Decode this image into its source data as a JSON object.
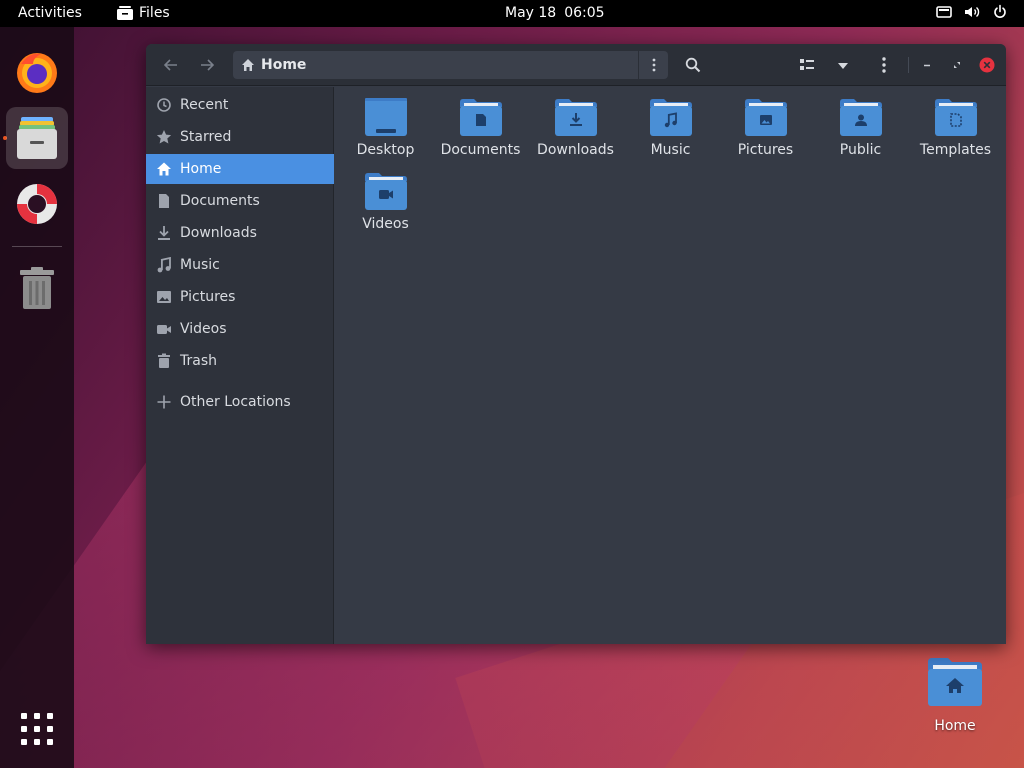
{
  "topbar": {
    "activities": "Activities",
    "app_name": "Files",
    "date": "May 18",
    "time": "06:05",
    "tray_icons": [
      "screen-icon",
      "volume-icon",
      "power-icon"
    ]
  },
  "dock": {
    "items": [
      {
        "name": "Firefox",
        "icon": "firefox-icon"
      },
      {
        "name": "Files",
        "icon": "files-icon",
        "active": true
      },
      {
        "name": "Help",
        "icon": "help-lifebuoy-icon"
      },
      {
        "name": "Trash",
        "icon": "trash-icon"
      }
    ],
    "show_apps_icon": "apps-grid-icon"
  },
  "window": {
    "path": {
      "location": "Home"
    },
    "sidebar": {
      "items": [
        {
          "label": "Recent",
          "icon": "clock-icon"
        },
        {
          "label": "Starred",
          "icon": "star-icon"
        },
        {
          "label": "Home",
          "icon": "home-icon",
          "selected": true
        },
        {
          "label": "Documents",
          "icon": "document-icon"
        },
        {
          "label": "Downloads",
          "icon": "download-icon"
        },
        {
          "label": "Music",
          "icon": "music-icon"
        },
        {
          "label": "Pictures",
          "icon": "picture-icon"
        },
        {
          "label": "Videos",
          "icon": "video-icon"
        },
        {
          "label": "Trash",
          "icon": "trash-icon"
        },
        {
          "label": "Other Locations",
          "icon": "plus-icon"
        }
      ]
    },
    "folders": [
      {
        "label": "Desktop",
        "icon": "desktop-folder-icon"
      },
      {
        "label": "Documents",
        "icon": "documents-folder-icon"
      },
      {
        "label": "Downloads",
        "icon": "downloads-folder-icon"
      },
      {
        "label": "Music",
        "icon": "music-folder-icon"
      },
      {
        "label": "Pictures",
        "icon": "pictures-folder-icon"
      },
      {
        "label": "Public",
        "icon": "public-folder-icon"
      },
      {
        "label": "Templates",
        "icon": "templates-folder-icon"
      },
      {
        "label": "Videos",
        "icon": "videos-folder-icon"
      }
    ]
  },
  "desktop": {
    "icons": [
      {
        "label": "Home",
        "icon": "home-folder-icon"
      }
    ]
  },
  "colors": {
    "accent": "#4a90e2",
    "folder": "#4a8fd6",
    "window_bg": "#353a45",
    "sidebar_bg": "#2e323b",
    "headerbar_bg": "#2b2f37",
    "close_button": "#e5323f"
  }
}
